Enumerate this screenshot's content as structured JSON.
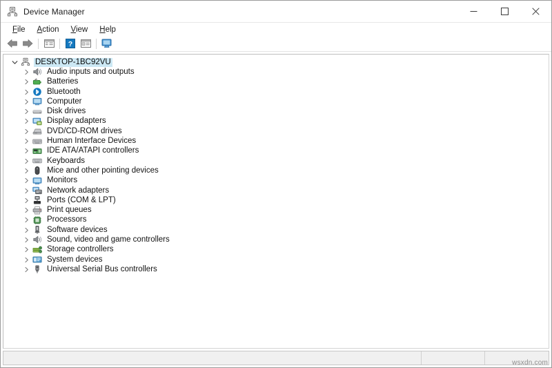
{
  "window": {
    "title": "Device Manager",
    "app_icon": "device-manager-icon",
    "controls": [
      {
        "name": "minimize",
        "glyph": "minimize-icon"
      },
      {
        "name": "maximize",
        "glyph": "maximize-icon"
      },
      {
        "name": "close",
        "glyph": "close-icon"
      }
    ]
  },
  "menubar": {
    "items": [
      {
        "label": "File",
        "accesskey": "F"
      },
      {
        "label": "Action",
        "accesskey": "A"
      },
      {
        "label": "View",
        "accesskey": "V"
      },
      {
        "label": "Help",
        "accesskey": "H"
      }
    ]
  },
  "toolbar": {
    "buttons": [
      {
        "name": "back-button",
        "icon": "back-arrow-icon",
        "tooltip": "Back"
      },
      {
        "name": "forward-button",
        "icon": "forward-arrow-icon",
        "tooltip": "Forward"
      },
      {
        "name": "show-hide-console-tree-button",
        "icon": "console-tree-icon",
        "tooltip": "Show/Hide Console Tree"
      },
      {
        "name": "help-button",
        "icon": "help-question-icon",
        "tooltip": "Help"
      },
      {
        "name": "properties-button",
        "icon": "properties-icon",
        "tooltip": "Properties"
      },
      {
        "name": "scan-hardware-changes-button",
        "icon": "scan-monitor-icon",
        "tooltip": "Scan for hardware changes"
      }
    ]
  },
  "tree": {
    "root": {
      "label": "DESKTOP-1BC92VU",
      "icon": "computer-node-icon",
      "expanded": true,
      "selected": true
    },
    "children": [
      {
        "label": "Audio inputs and outputs",
        "icon": "speaker-icon"
      },
      {
        "label": "Batteries",
        "icon": "battery-icon"
      },
      {
        "label": "Bluetooth",
        "icon": "bluetooth-icon"
      },
      {
        "label": "Computer",
        "icon": "monitor-icon"
      },
      {
        "label": "Disk drives",
        "icon": "disk-drive-icon"
      },
      {
        "label": "Display adapters",
        "icon": "display-adapter-icon"
      },
      {
        "label": "DVD/CD-ROM drives",
        "icon": "optical-drive-icon"
      },
      {
        "label": "Human Interface Devices",
        "icon": "hid-icon"
      },
      {
        "label": "IDE ATA/ATAPI controllers",
        "icon": "ide-controller-icon"
      },
      {
        "label": "Keyboards",
        "icon": "keyboard-icon"
      },
      {
        "label": "Mice and other pointing devices",
        "icon": "mouse-icon"
      },
      {
        "label": "Monitors",
        "icon": "monitor-icon"
      },
      {
        "label": "Network adapters",
        "icon": "network-adapter-icon"
      },
      {
        "label": "Ports (COM & LPT)",
        "icon": "port-icon"
      },
      {
        "label": "Print queues",
        "icon": "printer-icon"
      },
      {
        "label": "Processors",
        "icon": "processor-icon"
      },
      {
        "label": "Software devices",
        "icon": "software-device-icon"
      },
      {
        "label": "Sound, video and game controllers",
        "icon": "sound-controller-icon"
      },
      {
        "label": "Storage controllers",
        "icon": "storage-controller-icon"
      },
      {
        "label": "System devices",
        "icon": "system-device-icon"
      },
      {
        "label": "Universal Serial Bus controllers",
        "icon": "usb-controller-icon"
      }
    ]
  },
  "statusbar": {
    "main_text": "",
    "segment2_text": "",
    "segment3_text": ""
  },
  "watermark": {
    "text": "wsxdn.com"
  },
  "colors": {
    "selection": "#cce8f4",
    "accent_blue": "#1579c0",
    "window_border": "#9a9a9a",
    "statusbar_bg": "#f0f0f0",
    "text": "#121212"
  }
}
